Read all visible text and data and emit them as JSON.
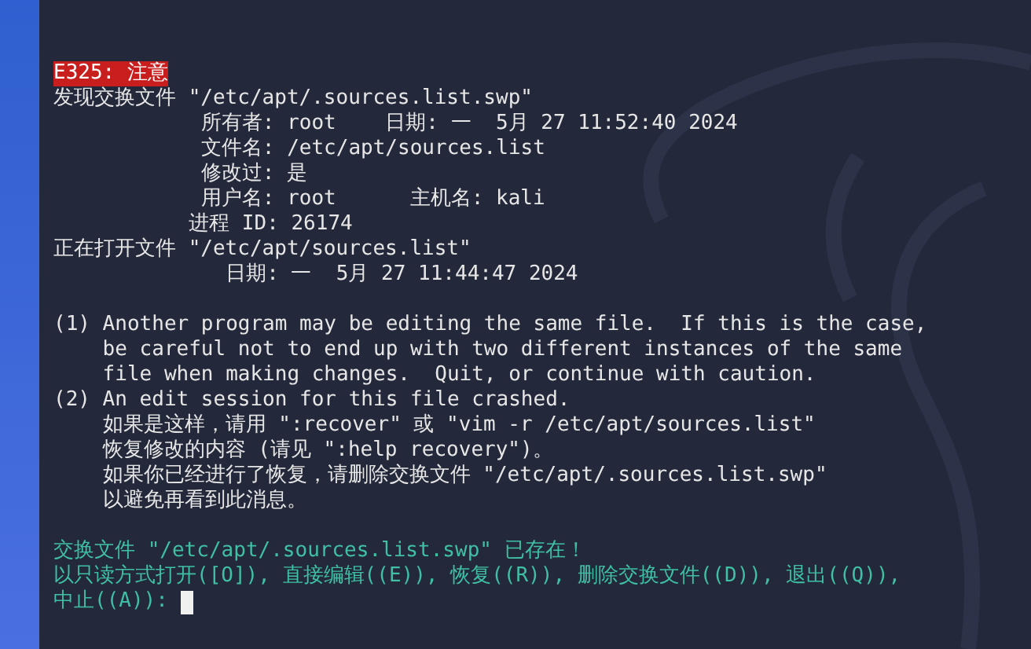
{
  "terminal": {
    "lines": [
      {
        "kind": "error",
        "text": "E325: 注意"
      },
      {
        "kind": "normal",
        "text": "发现交换文件 \"/etc/apt/.sources.list.swp\""
      },
      {
        "kind": "normal",
        "text": "            所有者: root    日期: 一  5月 27 11:52:40 2024"
      },
      {
        "kind": "normal",
        "text": "            文件名: /etc/apt/sources.list"
      },
      {
        "kind": "normal",
        "text": "            修改过: 是"
      },
      {
        "kind": "normal",
        "text": "            用户名: root      主机名: kali"
      },
      {
        "kind": "normal",
        "text": "           进程 ID: 26174"
      },
      {
        "kind": "normal",
        "text": "正在打开文件 \"/etc/apt/sources.list\""
      },
      {
        "kind": "normal",
        "text": "              日期: 一  5月 27 11:44:47 2024"
      },
      {
        "kind": "blank"
      },
      {
        "kind": "normal",
        "text": "(1) Another program may be editing the same file.  If this is the case,"
      },
      {
        "kind": "normal",
        "text": "    be careful not to end up with two different instances of the same"
      },
      {
        "kind": "normal",
        "text": "    file when making changes.  Quit, or continue with caution."
      },
      {
        "kind": "normal",
        "text": "(2) An edit session for this file crashed."
      },
      {
        "kind": "normal",
        "text": "    如果是这样，请用 \":recover\" 或 \"vim -r /etc/apt/sources.list\""
      },
      {
        "kind": "normal",
        "text": "    恢复修改的内容 (请见 \":help recovery\")。"
      },
      {
        "kind": "normal",
        "text": "    如果你已经进行了恢复，请删除交换文件 \"/etc/apt/.sources.list.swp\""
      },
      {
        "kind": "normal",
        "text": "    以避免再看到此消息。"
      },
      {
        "kind": "blank"
      },
      {
        "kind": "prompt",
        "text": "交换文件 \"/etc/apt/.sources.list.swp\" 已存在！"
      },
      {
        "kind": "prompt",
        "text": "以只读方式打开([O]), 直接编辑((E)), 恢复((R)), 删除交换文件((D)), 退出((Q)),"
      },
      {
        "kind": "prompt",
        "text": "中止((A)):"
      }
    ],
    "cursor": true
  }
}
